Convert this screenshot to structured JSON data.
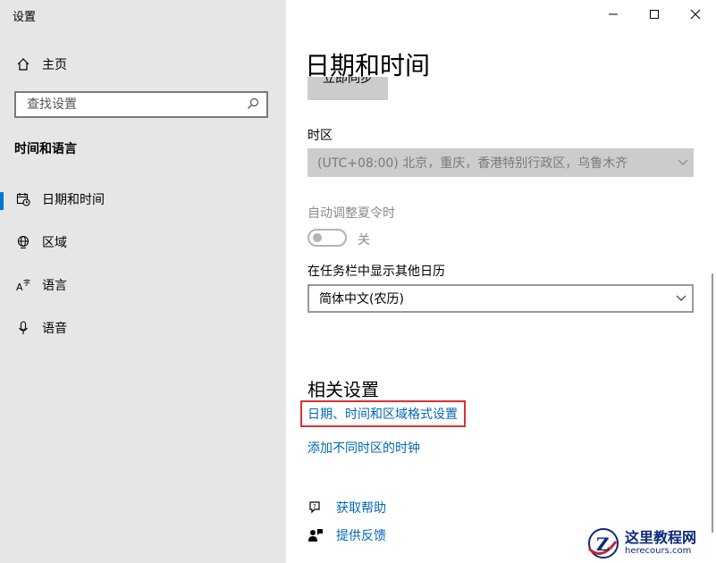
{
  "window": {
    "title": "设置"
  },
  "sidebar": {
    "home_label": "主页",
    "search_placeholder": "查找设置",
    "section_title": "时间和语言",
    "items": [
      {
        "label": "日期和时间",
        "icon": "calendar-clock-icon",
        "active": true
      },
      {
        "label": "区域",
        "icon": "globe-icon"
      },
      {
        "label": "语言",
        "icon": "language-icon"
      },
      {
        "label": "语音",
        "icon": "microphone-icon"
      }
    ]
  },
  "main": {
    "page_title": "日期和时间",
    "sync_button": "立即同步",
    "timezone": {
      "label": "时区",
      "value": "(UTC+08:00) 北京，重庆，香港特别行政区，乌鲁木齐"
    },
    "dst": {
      "label": "自动调整夏令时",
      "state": "关"
    },
    "calendar": {
      "label": "在任务栏中显示其他日历",
      "value": "简体中文(农历)"
    },
    "related": {
      "title": "相关设置",
      "links": [
        "日期、时间和区域格式设置",
        "添加不同时区的时钟"
      ]
    },
    "help": {
      "get_help": "获取帮助",
      "feedback": "提供反馈"
    }
  },
  "watermark": {
    "main": "这里教程网",
    "sub": "herecours.com",
    "logo_letter": "Z"
  },
  "colors": {
    "accent": "#0078d7",
    "link": "#0067b8",
    "highlight": "#e03030",
    "sidebar_bg": "#e6e6e6"
  }
}
